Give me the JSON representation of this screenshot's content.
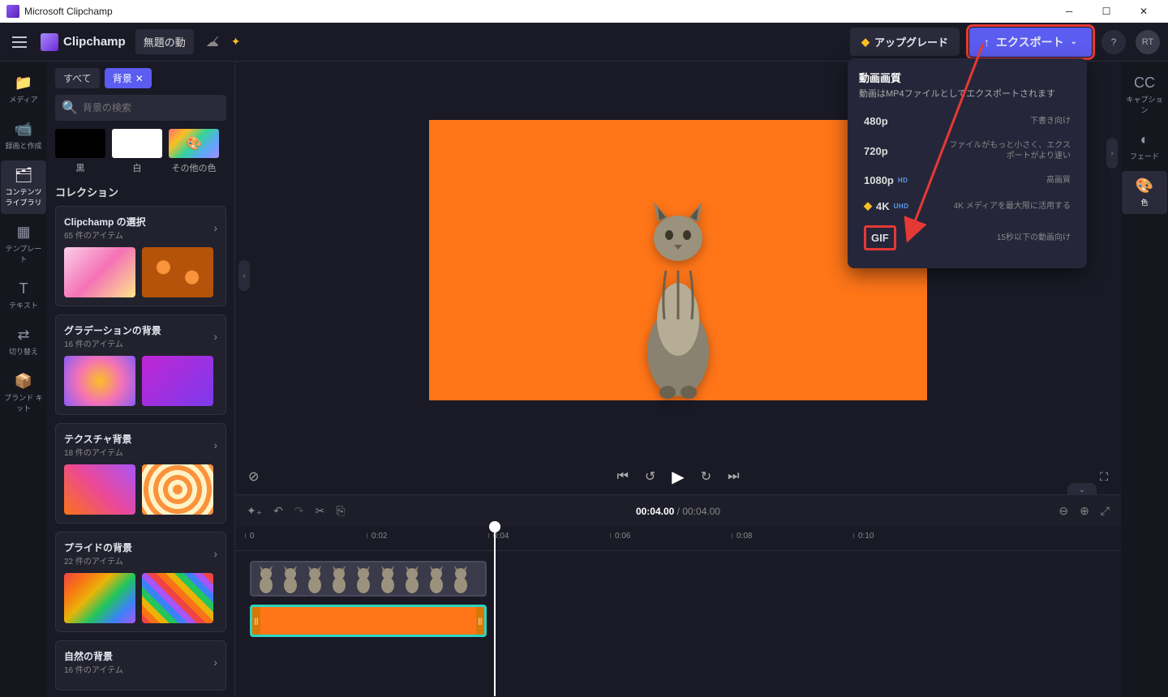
{
  "window": {
    "title": "Microsoft Clipchamp"
  },
  "header": {
    "brand": "Clipchamp",
    "project": "無題の動",
    "upgrade": "アップグレード",
    "export": "エクスポート",
    "avatar": "RT"
  },
  "leftrail": {
    "items": [
      {
        "icon": "📁",
        "label": "メディア"
      },
      {
        "icon": "📹",
        "label": "録画と作成"
      },
      {
        "icon": "🗂",
        "label": "コンテンツ ライブラリ"
      },
      {
        "icon": "▦",
        "label": "テンプレート"
      },
      {
        "icon": "T",
        "label": "テキスト"
      },
      {
        "icon": "⇄",
        "label": "切り替え"
      },
      {
        "icon": "📦",
        "label": "ブランド キット"
      }
    ]
  },
  "sidepanel": {
    "pill_all": "すべて",
    "pill_bg": "背景",
    "search_ph": "背景の検索",
    "swatches": [
      {
        "label": "黒"
      },
      {
        "label": "白"
      },
      {
        "label": "その他の色"
      }
    ],
    "section_title": "コレクション",
    "collections": [
      {
        "title": "Clipchamp の選択",
        "sub": "65 件のアイテム"
      },
      {
        "title": "グラデーションの背景",
        "sub": "16 件のアイテム"
      },
      {
        "title": "テクスチャ背景",
        "sub": "18 件のアイテム"
      },
      {
        "title": "プライドの背景",
        "sub": "22 件のアイテム"
      },
      {
        "title": "自然の背景",
        "sub": "16 件のアイテム"
      }
    ]
  },
  "timeline": {
    "current": "00:04.00",
    "total": "00:04.00",
    "ticks": [
      "0",
      "0:02",
      "0:04",
      "0:06",
      "0:08",
      "0:10"
    ]
  },
  "rightrail": {
    "items": [
      {
        "icon": "CC",
        "label": "キャプション"
      },
      {
        "icon": "◐",
        "label": "フェード"
      },
      {
        "icon": "🎨",
        "label": "色"
      }
    ]
  },
  "export_menu": {
    "title": "動画画質",
    "subtitle": "動画はMP4ファイルとしてエクスポートされます",
    "options": [
      {
        "q": "480p",
        "desc": "下書き向け"
      },
      {
        "q": "720p",
        "desc": "ファイルがもっと小さく、エクスポートがより速い"
      },
      {
        "q": "1080p",
        "badge": "HD",
        "desc": "高画質"
      },
      {
        "q": "4K",
        "badge": "UHD",
        "premium": true,
        "desc": "4K メディアを最大限に活用する"
      },
      {
        "q": "GIF",
        "desc": "15秒以下の動画向け"
      }
    ]
  }
}
